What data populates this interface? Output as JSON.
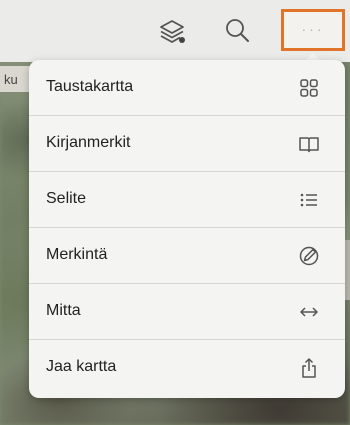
{
  "map": {
    "strip_text": "ku"
  },
  "toolbar": {
    "layers_icon": "layers-icon",
    "search_icon": "search-icon",
    "more_icon": "more-icon",
    "more_dots": "···",
    "highlight_color": "#e0752a"
  },
  "menu": {
    "items": [
      {
        "label": "Taustakartta",
        "icon": "basemap-grid-icon"
      },
      {
        "label": "Kirjanmerkit",
        "icon": "bookmarks-book-icon"
      },
      {
        "label": "Selite",
        "icon": "legend-list-icon"
      },
      {
        "label": "Merkintä",
        "icon": "markup-pencil-icon"
      },
      {
        "label": "Mitta",
        "icon": "measure-arrows-icon"
      },
      {
        "label": "Jaa kartta",
        "icon": "share-icon"
      }
    ]
  }
}
